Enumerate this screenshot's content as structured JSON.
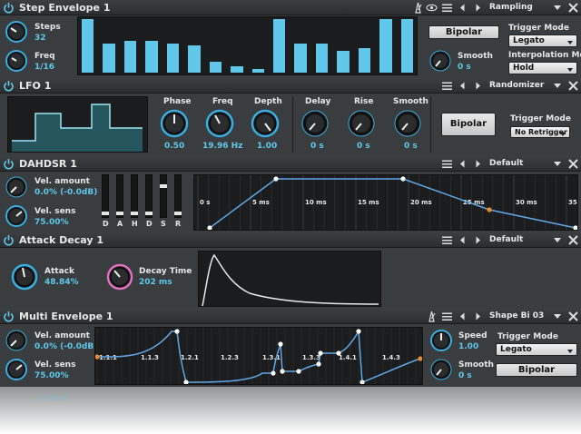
{
  "colors": {
    "accent": "#5fc8ea",
    "panel": "#1b1c1e",
    "bg": "#3a3d40",
    "knob_ring": "#3aaee0",
    "attack_knob_ring": "#e070c0"
  },
  "step_envelope": {
    "title": "Step Envelope 1",
    "preset": "Rampling",
    "steps": {
      "label": "Steps",
      "value": "32"
    },
    "freq": {
      "label": "Freq",
      "value": "1/16"
    },
    "bar_levels": [
      1.0,
      0.55,
      0.6,
      0.6,
      0.55,
      0.5,
      0.2,
      0.12,
      0.06,
      1.0,
      0.55,
      0.55,
      0.4,
      0.45,
      1.0,
      1.0
    ],
    "bipolar": "Bipolar",
    "smooth": {
      "label": "Smooth",
      "value": "0 s"
    },
    "trigger_mode": {
      "label": "Trigger Mode",
      "value": "Legato"
    },
    "interp_mode": {
      "label": "Interpolation Mode",
      "value": "Hold"
    }
  },
  "lfo": {
    "title": "LFO 1",
    "preset": "Randomizer",
    "phase": {
      "label": "Phase",
      "value": "0.50"
    },
    "freq": {
      "label": "Freq",
      "value": "19.96 Hz"
    },
    "depth": {
      "label": "Depth",
      "value": "1.00"
    },
    "delay": {
      "label": "Delay",
      "value": "0 s"
    },
    "rise": {
      "label": "Rise",
      "value": "0 s"
    },
    "smooth": {
      "label": "Smooth",
      "value": "0 s"
    },
    "bipolar": "Bipolar",
    "trigger_mode": {
      "label": "Trigger Mode",
      "value": "No Retrigger"
    }
  },
  "dahdsr": {
    "title": "DAHDSR 1",
    "preset": "Default",
    "vel_amount": {
      "label": "Vel. amount",
      "value": "0.0% (-0.0dB)"
    },
    "vel_sens": {
      "label": "Vel. sens",
      "value": "75.00%"
    },
    "sliders": [
      "D",
      "A",
      "H",
      "D",
      "S",
      "R"
    ],
    "slider_levels": [
      0.0,
      0.0,
      0.0,
      0.0,
      0.75,
      0.0
    ],
    "time_ticks": [
      "0 s",
      "5 ms",
      "10 ms",
      "15 ms",
      "20 ms",
      "25 ms",
      "30 ms",
      "35 ms"
    ]
  },
  "attack_decay": {
    "title": "Attack Decay 1",
    "preset": "Default",
    "attack": {
      "label": "Attack",
      "value": "48.84%"
    },
    "decay": {
      "label": "Decay Time",
      "value": "202 ms"
    }
  },
  "multi_envelope": {
    "title": "Multi Envelope 1",
    "preset": "Shape Bi 03",
    "vel_amount": {
      "label": "Vel. amount",
      "value": "0.0% (-0.0dB)"
    },
    "vel_sens": {
      "label": "Vel. sens",
      "value": "75.00%"
    },
    "segment_labels": [
      "1.1.1",
      "1.1.3",
      "1.2.1",
      "1.2.3",
      "1.3.1",
      "1.3.3",
      "1.4.1",
      "1.4.3"
    ],
    "speed": {
      "label": "Speed",
      "value": "1.00"
    },
    "smooth": {
      "label": "Smooth",
      "value": "0 s"
    },
    "trigger_mode": {
      "label": "Trigger Mode",
      "value": "Legato"
    },
    "bipolar": "Bipolar"
  },
  "reflection": {
    "value": "75.00%"
  }
}
